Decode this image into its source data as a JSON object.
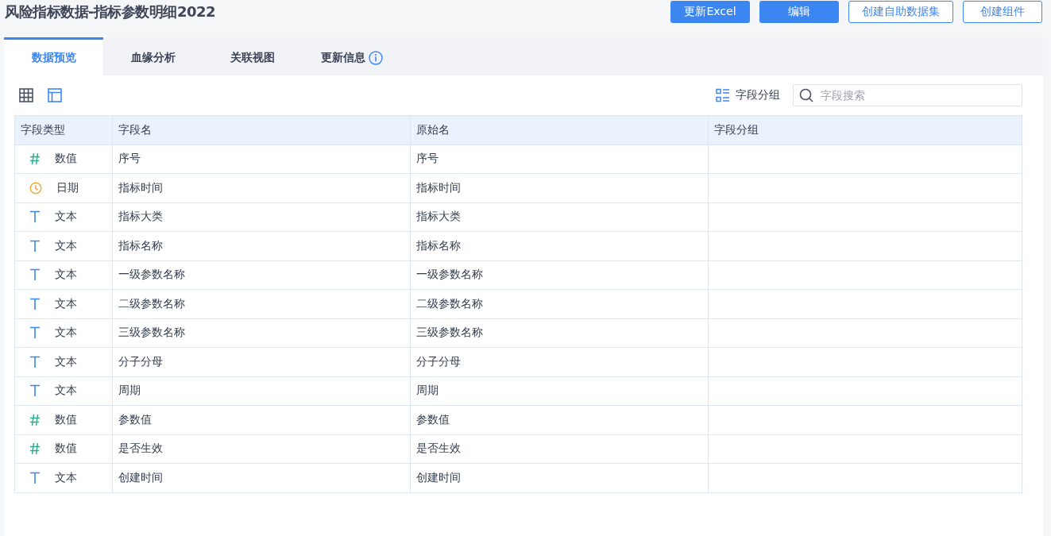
{
  "title": "风险指标数据-指标参数明细2022",
  "buttons": [
    {
      "label": "更新Excel",
      "kind": "primary"
    },
    {
      "label": "编辑",
      "kind": "primary"
    },
    {
      "label": "创建自助数据集",
      "kind": "outline"
    },
    {
      "label": "创建组件",
      "kind": "outline"
    }
  ],
  "tabs": [
    {
      "label": "数据预览",
      "selected": true,
      "info": false
    },
    {
      "label": "血缘分析",
      "selected": false,
      "info": false
    },
    {
      "label": "关联视图",
      "selected": false,
      "info": false
    },
    {
      "label": "更新信息",
      "selected": false,
      "info": true
    }
  ],
  "view_toggles": [
    {
      "kind": "grid",
      "selected": false
    },
    {
      "kind": "layout",
      "selected": true
    }
  ],
  "group_button": "字段分组",
  "search": {
    "placeholder": "字段搜索"
  },
  "table": {
    "columns": [
      "字段类型",
      "字段名",
      "原始名",
      "字段分组"
    ],
    "rows": [
      {
        "kind": "number",
        "type": "数值",
        "name": "序号",
        "original": "序号"
      },
      {
        "kind": "date",
        "type": "日期",
        "name": "指标时间",
        "original": "指标时间"
      },
      {
        "kind": "text",
        "type": "文本",
        "name": "指标大类",
        "original": "指标大类"
      },
      {
        "kind": "text",
        "type": "文本",
        "name": "指标名称",
        "original": "指标名称"
      },
      {
        "kind": "text",
        "type": "文本",
        "name": "一级参数名称",
        "original": "一级参数名称"
      },
      {
        "kind": "text",
        "type": "文本",
        "name": "二级参数名称",
        "original": "二级参数名称"
      },
      {
        "kind": "text",
        "type": "文本",
        "name": "三级参数名称",
        "original": "三级参数名称"
      },
      {
        "kind": "text",
        "type": "文本",
        "name": "分子分母",
        "original": "分子分母"
      },
      {
        "kind": "text",
        "type": "文本",
        "name": "周期",
        "original": "周期"
      },
      {
        "kind": "number",
        "type": "数值",
        "name": "参数值",
        "original": "参数值"
      },
      {
        "kind": "number",
        "type": "数值",
        "name": "是否生效",
        "original": "是否生效"
      },
      {
        "kind": "text",
        "type": "文本",
        "name": "创建时间",
        "original": "创建时间"
      }
    ]
  }
}
